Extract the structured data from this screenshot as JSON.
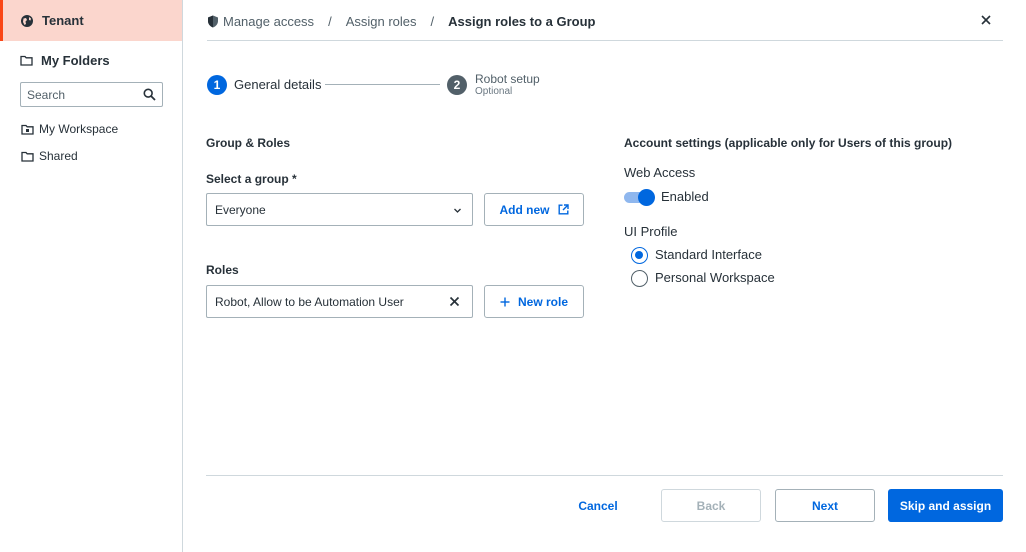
{
  "sidebar": {
    "tenant_label": "Tenant",
    "my_folders_label": "My Folders",
    "search_placeholder": "Search",
    "items": [
      {
        "label": "My Workspace",
        "icon": "workspace-folder-icon"
      },
      {
        "label": "Shared",
        "icon": "folder-icon"
      }
    ]
  },
  "breadcrumb": {
    "items": [
      "Manage access",
      "Assign roles",
      "Assign roles to a Group"
    ],
    "separator": "/"
  },
  "stepper": {
    "steps": [
      {
        "number": "1",
        "label": "General details",
        "sublabel": ""
      },
      {
        "number": "2",
        "label": "Robot setup",
        "sublabel": "Optional"
      }
    ]
  },
  "group_roles": {
    "title": "Group & Roles",
    "select_group_label": "Select a group *",
    "select_group_value": "Everyone",
    "add_new_label": "Add new",
    "roles_label": "Roles",
    "roles_value": "Robot, Allow to be Automation User",
    "new_role_label": "New role"
  },
  "account_settings": {
    "title": "Account settings (applicable only for Users of this group)",
    "web_access_label": "Web Access",
    "web_access_state": "Enabled",
    "web_access_enabled": true,
    "ui_profile_label": "UI Profile",
    "ui_profile_options": [
      {
        "label": "Standard Interface",
        "selected": true
      },
      {
        "label": "Personal Workspace",
        "selected": false
      }
    ]
  },
  "footer": {
    "cancel_label": "Cancel",
    "back_label": "Back",
    "next_label": "Next",
    "skip_assign_label": "Skip and assign"
  },
  "colors": {
    "accent": "#0067df",
    "tenant_highlight": "#fbd6cd",
    "tenant_border": "#fa4616"
  }
}
